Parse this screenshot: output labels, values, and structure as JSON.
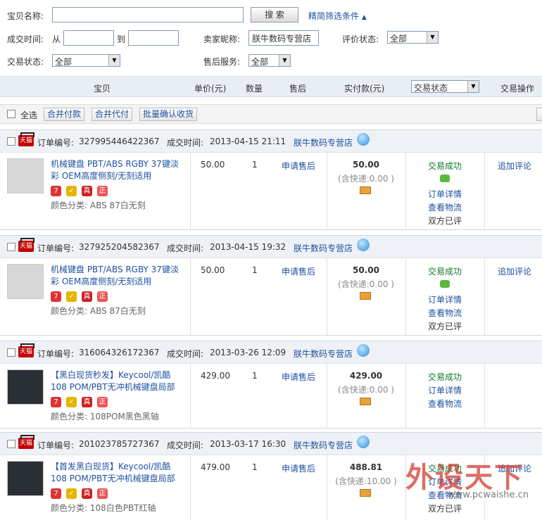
{
  "filters": {
    "item_name_label": "宝贝名称:",
    "search_button": "搜 索",
    "refine_link": "精简筛选条件",
    "deal_time_label": "成交时间:",
    "from_label": "从",
    "to_label": "到",
    "seller_nick_label": "卖家昵称:",
    "seller_nick_value": "朕牛数码专营店",
    "rating_status_label": "评价状态:",
    "rating_status_value": "全部",
    "trade_status_label": "交易状态:",
    "trade_status_value": "全部",
    "after_sale_label": "售后服务:",
    "after_sale_value": "全部"
  },
  "columns": {
    "item": "宝贝",
    "unit_price": "单价(元)",
    "qty": "数量",
    "after_sale": "售后",
    "paid": "实付款(元)",
    "trade_status": "交易状态",
    "action": "交易操作"
  },
  "toolbar": {
    "select_all": "全选",
    "merge_pay": "合并付款",
    "merge_proxy": "合并代付",
    "batch_confirm": "批量确认收货"
  },
  "labels": {
    "order_no": "订单编号:",
    "deal_time": "成交时间:",
    "tmall": "天猫"
  },
  "orders": [
    {
      "order_no": "327995446422367",
      "time": "2013-04-15 21:11",
      "shop": "朕牛数码专营店",
      "title": "机械键盘 PBT/ABS RGBY 37键淡彩 OEM高度侧刻/无刻适用",
      "spec": "颜色分类: ABS 87白无刻",
      "price": "50.00",
      "qty": "1",
      "after": "申请售后",
      "paid": "50.00",
      "ship": "(含快递:0.00 )",
      "status": "交易成功",
      "detail": "订单详情",
      "logistics": "查看物流",
      "rated": "双方已评",
      "action": "追加评论"
    },
    {
      "order_no": "327925204582367",
      "time": "2013-04-15 19:32",
      "shop": "朕牛数码专营店",
      "title": "机械键盘 PBT/ABS RGBY 37键淡彩 OEM高度侧刻/无刻适用",
      "spec": "颜色分类: ABS 87白无刻",
      "price": "50.00",
      "qty": "1",
      "after": "申请售后",
      "paid": "50.00",
      "ship": "(含快递:0.00 )",
      "status": "交易成功",
      "detail": "订单详情",
      "logistics": "查看物流",
      "rated": "双方已评",
      "action": "追加评论"
    },
    {
      "order_no": "316064326172367",
      "time": "2013-03-26 12:09",
      "shop": "朕牛数码专营店",
      "title": "【黑白现货秒发】Keycool/凯酷 108 POM/PBT无冲机械键盘局部",
      "spec": "颜色分类: 108POM黑色黑轴",
      "price": "429.00",
      "qty": "1",
      "after": "申请售后",
      "paid": "429.00",
      "ship": "(含快递:0.00 )",
      "status": "交易成功",
      "detail": "订单详情",
      "logistics": "查看物流",
      "rated": "",
      "action": ""
    },
    {
      "order_no": "201023785727367",
      "time": "2013-03-17 16:30",
      "shop": "朕牛数码专营店",
      "title": "【首发黑白现货】Keycool/凯酷 108 POM/PBT无冲机械键盘局部",
      "spec": "颜色分类: 108白色PBT红轴",
      "price": "479.00",
      "qty": "1",
      "after": "申请售后",
      "paid": "488.81",
      "ship": "(含快递:10.00 )",
      "status": "交易成功",
      "detail": "订单详情",
      "logistics": "查看物流",
      "rated": "双方已评",
      "action": "追加评论"
    }
  ],
  "watermark": {
    "big": "外设天下",
    "small": "www.pcwaishe.cn"
  }
}
